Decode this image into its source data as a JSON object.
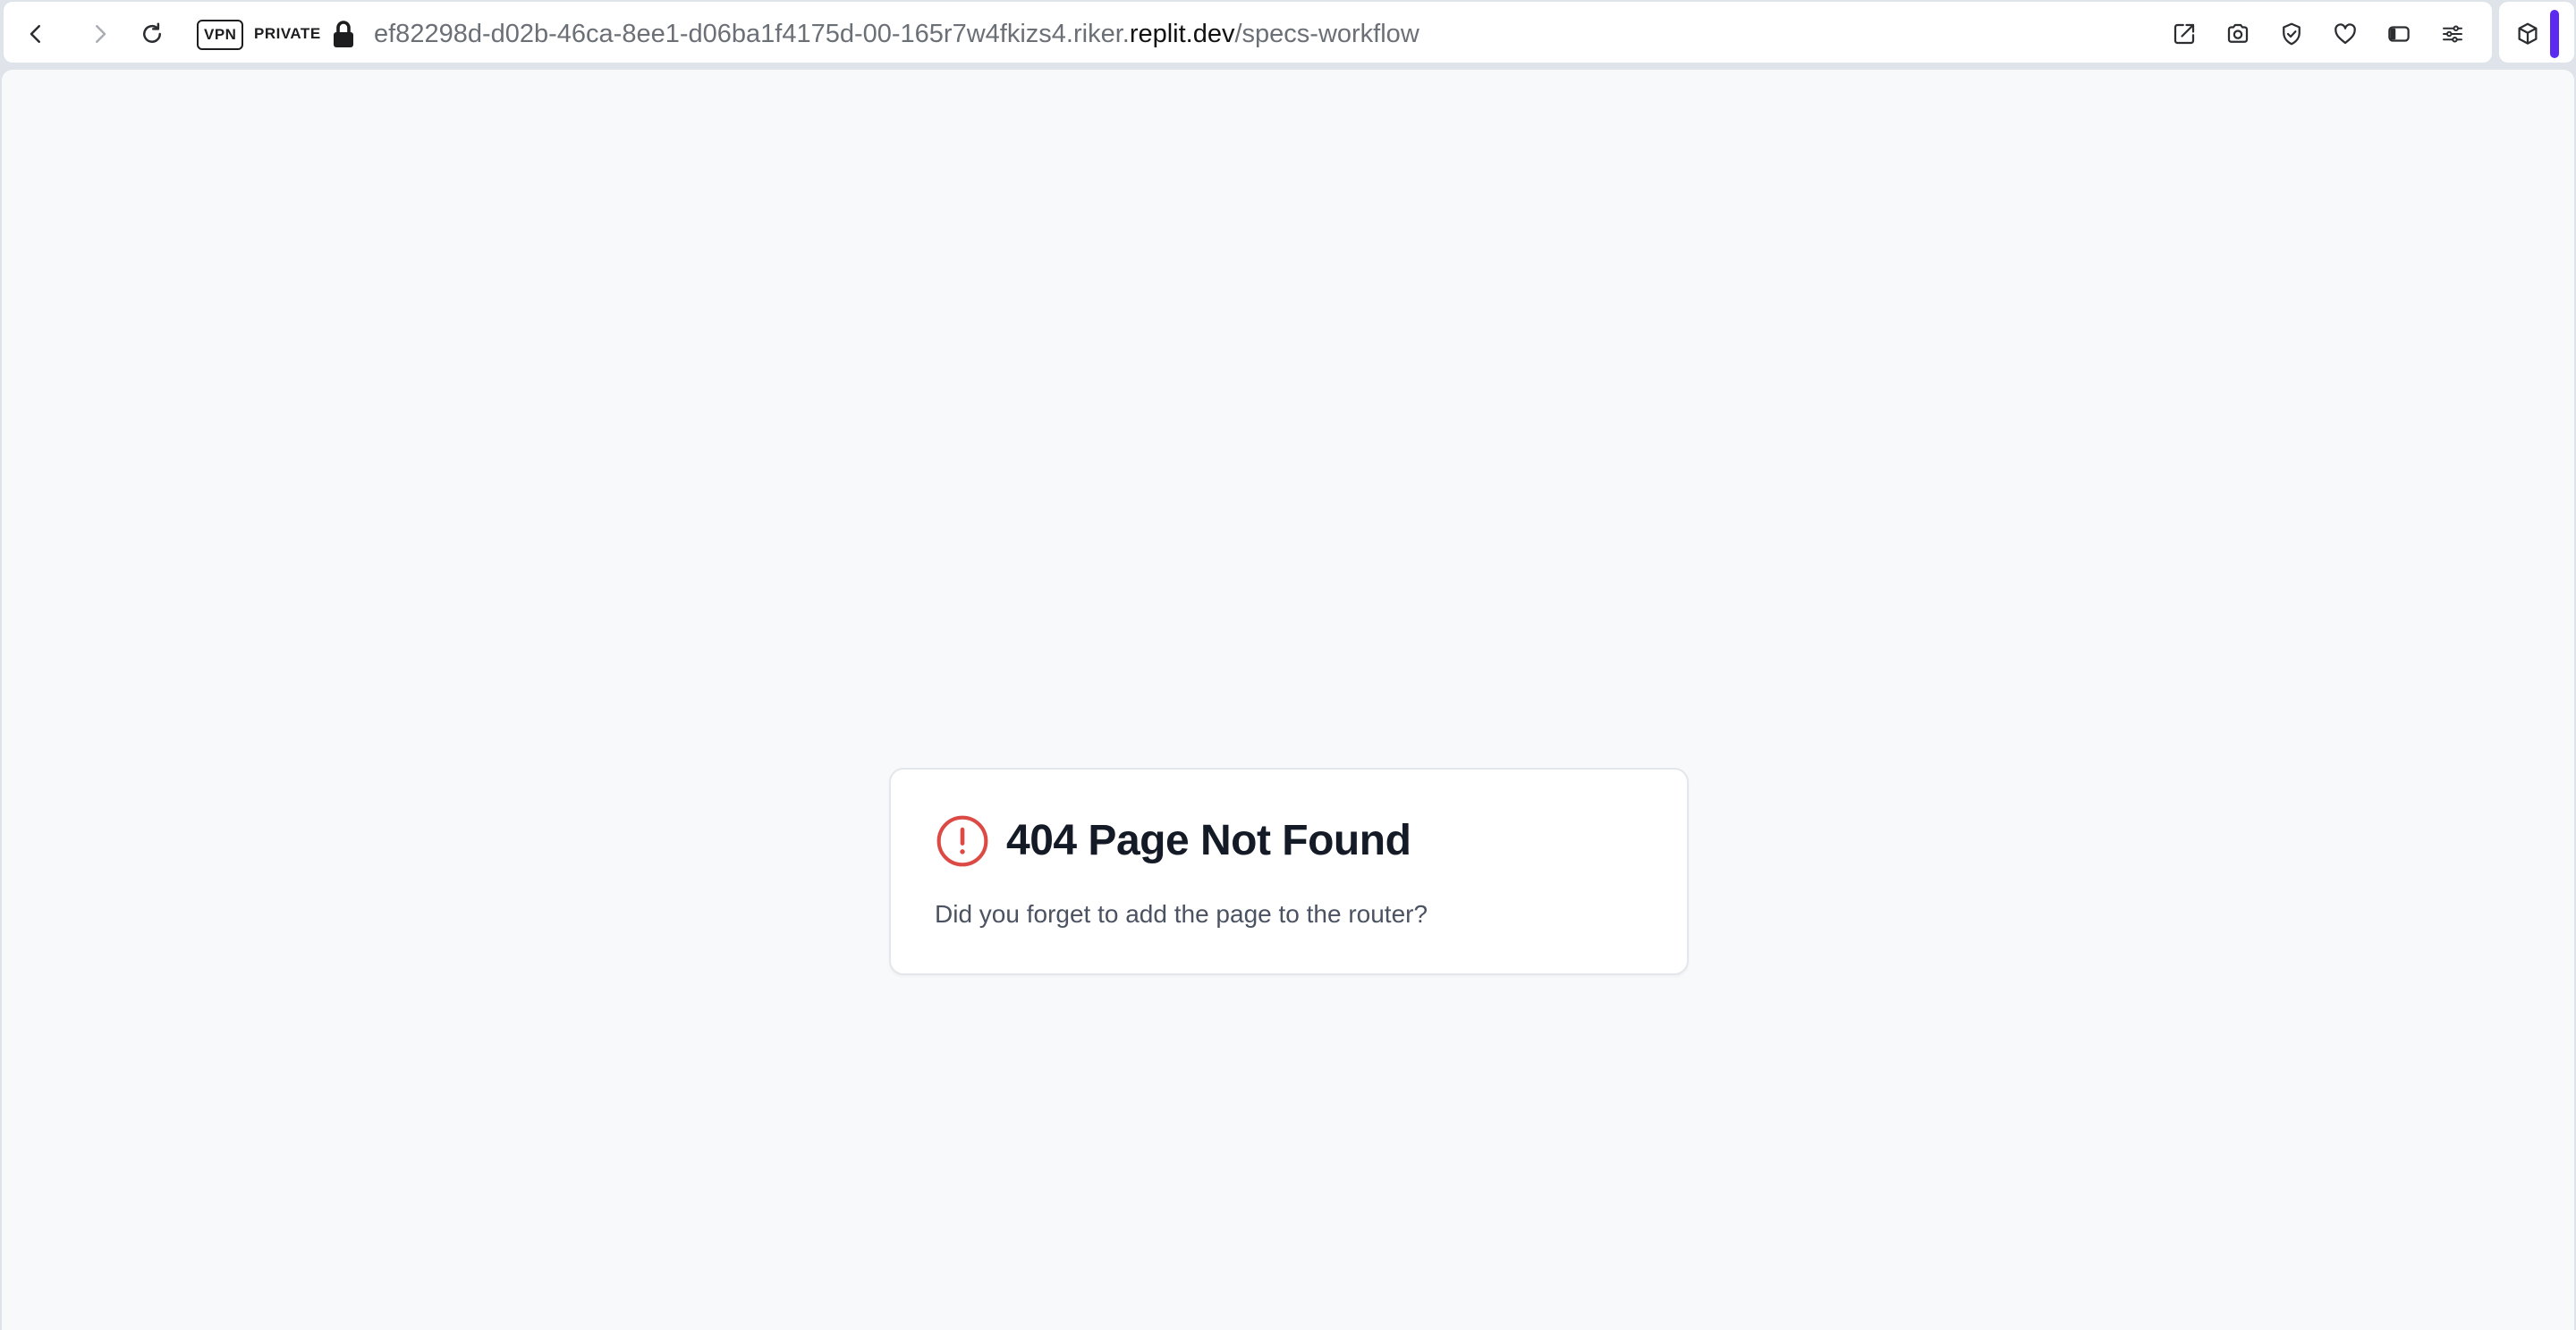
{
  "browser": {
    "vpn_label": "VPN",
    "private_label": "PRIVATE",
    "url": {
      "prefix": "ef82298d-d02b-46ca-8ee1-d06ba1f4175d-00-165r7w4fkizs4.riker.",
      "host": "replit.dev",
      "path": "/specs-workflow"
    },
    "nav_icons": [
      "back-icon",
      "forward-icon",
      "reload-icon"
    ],
    "toolbar_icons": [
      "share-icon",
      "camera-icon",
      "shield-check-icon",
      "heart-icon",
      "sidebar-icon",
      "tune-icon",
      "cube-icon"
    ],
    "accent_color": "#5b2bf0"
  },
  "error_card": {
    "icon": "alert-circle-icon",
    "icon_color": "#dc4a45",
    "title": "404 Page Not Found",
    "description": "Did you forget to add the page to the router?"
  }
}
